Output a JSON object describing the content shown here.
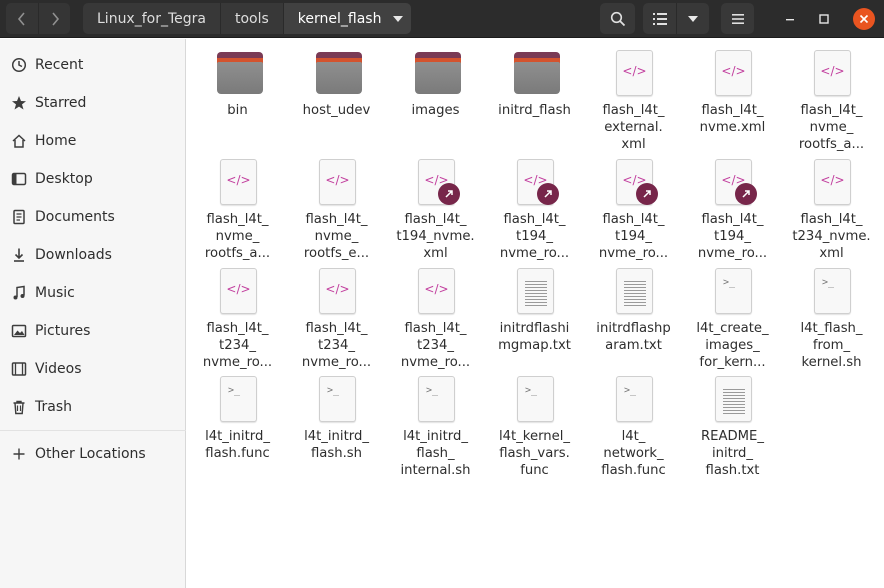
{
  "path": {
    "crumbs": [
      "Linux_for_Tegra",
      "tools",
      "kernel_flash"
    ]
  },
  "sidebar": {
    "items": [
      {
        "label": "Recent",
        "icon": "clock-icon"
      },
      {
        "label": "Starred",
        "icon": "star-icon"
      },
      {
        "label": "Home",
        "icon": "home-icon"
      },
      {
        "label": "Desktop",
        "icon": "desktop-icon"
      },
      {
        "label": "Documents",
        "icon": "documents-icon"
      },
      {
        "label": "Downloads",
        "icon": "downloads-icon"
      },
      {
        "label": "Music",
        "icon": "music-icon"
      },
      {
        "label": "Pictures",
        "icon": "pictures-icon"
      },
      {
        "label": "Videos",
        "icon": "videos-icon"
      },
      {
        "label": "Trash",
        "icon": "trash-icon"
      },
      {
        "label": "Other Locations",
        "icon": "plus-icon"
      }
    ]
  },
  "files": [
    {
      "name": "bin",
      "type": "folder"
    },
    {
      "name": "host_udev",
      "type": "folder"
    },
    {
      "name": "images",
      "type": "folder"
    },
    {
      "name": "initrd_flash",
      "type": "folder"
    },
    {
      "name": "flash_l4t_\nexternal.\nxml",
      "type": "xml"
    },
    {
      "name": "flash_l4t_\nnvme.xml",
      "type": "xml"
    },
    {
      "name": "flash_l4t_\nnvme_\nrootfs_a...",
      "type": "xml"
    },
    {
      "name": "flash_l4t_\nnvme_\nrootfs_a...",
      "type": "xml"
    },
    {
      "name": "flash_l4t_\nnvme_\nrootfs_e...",
      "type": "xml"
    },
    {
      "name": "flash_l4t_\nt194_nvme.\nxml",
      "type": "xml-link"
    },
    {
      "name": "flash_l4t_\nt194_\nnvme_ro...",
      "type": "xml-link"
    },
    {
      "name": "flash_l4t_\nt194_\nnvme_ro...",
      "type": "xml-link"
    },
    {
      "name": "flash_l4t_\nt194_\nnvme_ro...",
      "type": "xml-link"
    },
    {
      "name": "flash_l4t_\nt234_nvme.\nxml",
      "type": "xml"
    },
    {
      "name": "flash_l4t_\nt234_\nnvme_ro...",
      "type": "xml"
    },
    {
      "name": "flash_l4t_\nt234_\nnvme_ro...",
      "type": "xml"
    },
    {
      "name": "flash_l4t_\nt234_\nnvme_ro...",
      "type": "xml"
    },
    {
      "name": "initrdflashi\nmgmap.txt",
      "type": "text"
    },
    {
      "name": "initrdflashp\naram.txt",
      "type": "text"
    },
    {
      "name": "l4t_create_\nimages_\nfor_kern...",
      "type": "script"
    },
    {
      "name": "l4t_flash_\nfrom_\nkernel.sh",
      "type": "script"
    },
    {
      "name": "l4t_initrd_\nflash.func",
      "type": "script"
    },
    {
      "name": "l4t_initrd_\nflash.sh",
      "type": "script"
    },
    {
      "name": "l4t_initrd_\nflash_\ninternal.sh",
      "type": "script"
    },
    {
      "name": "l4t_kernel_\nflash_vars.\nfunc",
      "type": "script"
    },
    {
      "name": "l4t_\nnetwork_\nflash.func",
      "type": "script"
    },
    {
      "name": "README_\ninitrd_\nflash.txt",
      "type": "text"
    }
  ],
  "colors": {
    "accent": "#e95420",
    "folder_tab": "#7a3a55",
    "link_badge": "#77264a",
    "xml_glyph": "#c23f9e"
  }
}
